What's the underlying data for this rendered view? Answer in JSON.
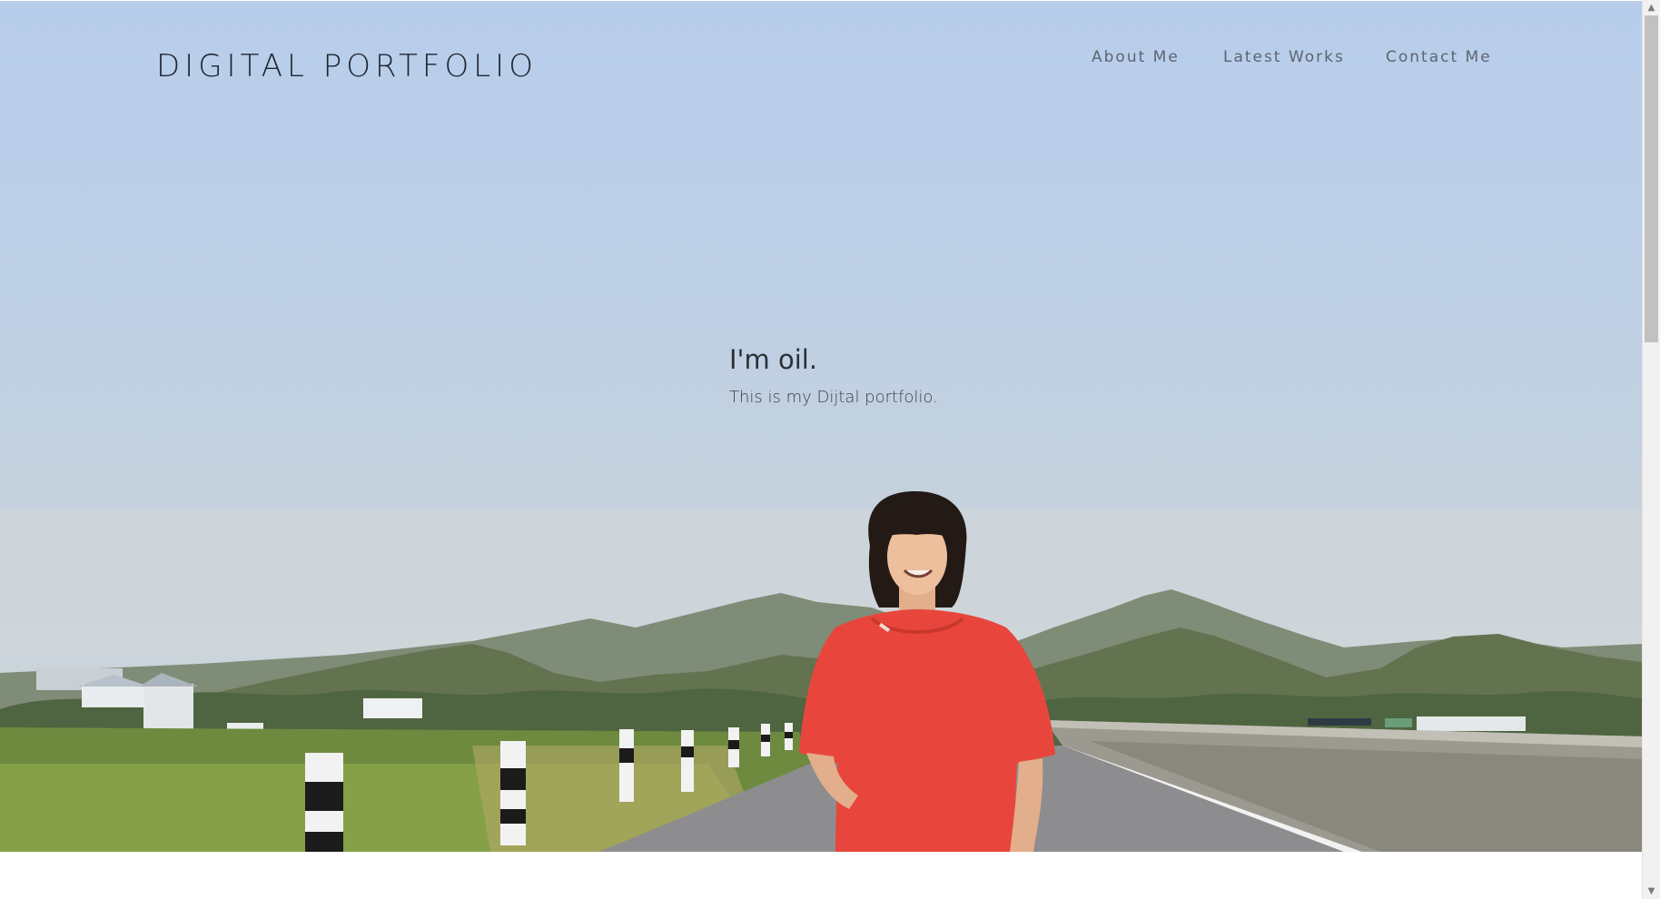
{
  "header": {
    "brand": "DIGITAL PORTFOLIO",
    "nav": [
      {
        "label": "About Me"
      },
      {
        "label": "Latest Works"
      },
      {
        "label": "Contact Me"
      }
    ]
  },
  "hero": {
    "heading": "I'm oil.",
    "subheading": "This is my Dijtal portfolio.",
    "colors": {
      "sky": "#bccfe8",
      "shirt": "#e8463c",
      "hills": "#5d6f4d"
    }
  },
  "scrollbar": {
    "up_icon": "chevron-up-icon",
    "down_icon": "chevron-down-icon"
  }
}
